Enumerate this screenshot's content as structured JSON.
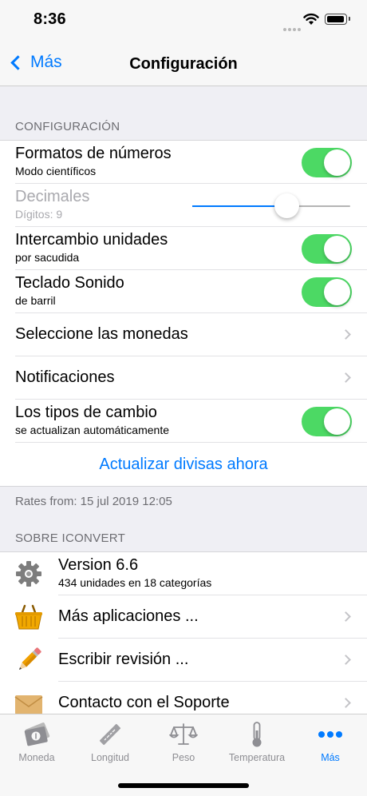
{
  "status": {
    "time": "8:36"
  },
  "nav": {
    "back_label": "Más",
    "title": "Configuración"
  },
  "settings": {
    "header": "CONFIGURACIÓN",
    "rows": [
      {
        "title": "Formatos de números",
        "subtitle": "Modo científicos",
        "control": "toggle",
        "on": true
      },
      {
        "title": "Decimales",
        "subtitle": "Dígitos: 9",
        "control": "slider",
        "value": 9,
        "min": 0,
        "max": 15,
        "enabled": false
      },
      {
        "title": "Intercambio unidades",
        "subtitle": "por sacudida",
        "control": "toggle",
        "on": true
      },
      {
        "title": "Teclado Sonido",
        "subtitle": "de barril",
        "control": "toggle",
        "on": true
      },
      {
        "title": "Seleccione las monedas",
        "control": "disclosure"
      },
      {
        "title": "Notificaciones",
        "control": "disclosure"
      },
      {
        "title": "Los tipos de cambio",
        "subtitle": "se actualizan automáticamente",
        "control": "toggle",
        "on": true
      }
    ],
    "update_action": "Actualizar divisas ahora",
    "footer": "Rates from: 15 jul 2019 12:05"
  },
  "about": {
    "header": "SOBRE ICONVERT",
    "rows": [
      {
        "icon": "gear-icon",
        "title": "Version 6.6",
        "subtitle": "434 unidades en 18 categorías",
        "control": "none"
      },
      {
        "icon": "basket-icon",
        "title": "Más aplicaciones ...",
        "control": "disclosure"
      },
      {
        "icon": "pencil-icon",
        "title": "Escribir revisión ...",
        "control": "disclosure"
      },
      {
        "icon": "envelope-icon",
        "title": "Contacto con el Soporte",
        "control": "disclosure"
      }
    ]
  },
  "tabs": [
    {
      "label": "Moneda",
      "icon": "money-icon",
      "active": false
    },
    {
      "label": "Longitud",
      "icon": "ruler-icon",
      "active": false
    },
    {
      "label": "Peso",
      "icon": "scale-icon",
      "active": false
    },
    {
      "label": "Temperatura",
      "icon": "thermometer-icon",
      "active": false
    },
    {
      "label": "Más",
      "icon": "more-icon",
      "active": true
    }
  ],
  "colors": {
    "accent": "#007aff",
    "toggle_on": "#4cd964"
  }
}
